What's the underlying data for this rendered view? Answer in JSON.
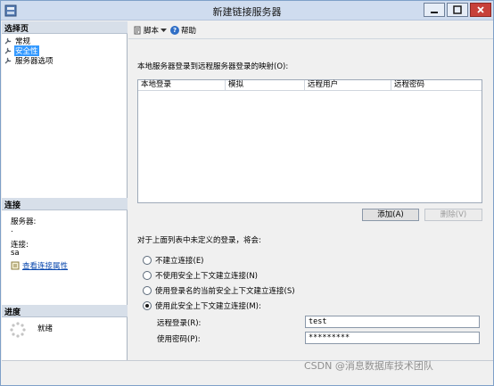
{
  "window": {
    "title": "新建链接服务器"
  },
  "left": {
    "select_page_header": "选择页",
    "pages": [
      {
        "label": "常规"
      },
      {
        "label": "安全性"
      },
      {
        "label": "服务器选项"
      }
    ],
    "connection_header": "连接",
    "server_label": "服务器:",
    "server_value": ".",
    "connection_label": "连接:",
    "connection_value": "sa",
    "view_connection_link": "查看连接属性",
    "progress_header": "进度",
    "progress_status": "就绪"
  },
  "toolbar": {
    "script_label": "脚本",
    "help_label": "帮助"
  },
  "main": {
    "mapping_label": "本地服务器登录到远程服务器登录的映射(O):",
    "columns": [
      "本地登录",
      "模拟",
      "远程用户",
      "远程密码"
    ],
    "add_button": "添加(A)",
    "remove_button": "删除(V)",
    "undefined_label": "对于上面列表中未定义的登录，将会:",
    "options": [
      {
        "label": "不建立连接(E)",
        "checked": false
      },
      {
        "label": "不使用安全上下文建立连接(N)",
        "checked": false
      },
      {
        "label": "使用登录名的当前安全上下文建立连接(S)",
        "checked": false
      },
      {
        "label": "使用此安全上下文建立连接(M):",
        "checked": true
      }
    ],
    "remote_login_label": "远程登录(R):",
    "remote_login_value": "test",
    "password_label": "使用密码(P):",
    "password_value": "*********"
  },
  "watermark": "CSDN @消息数据库技术团队"
}
